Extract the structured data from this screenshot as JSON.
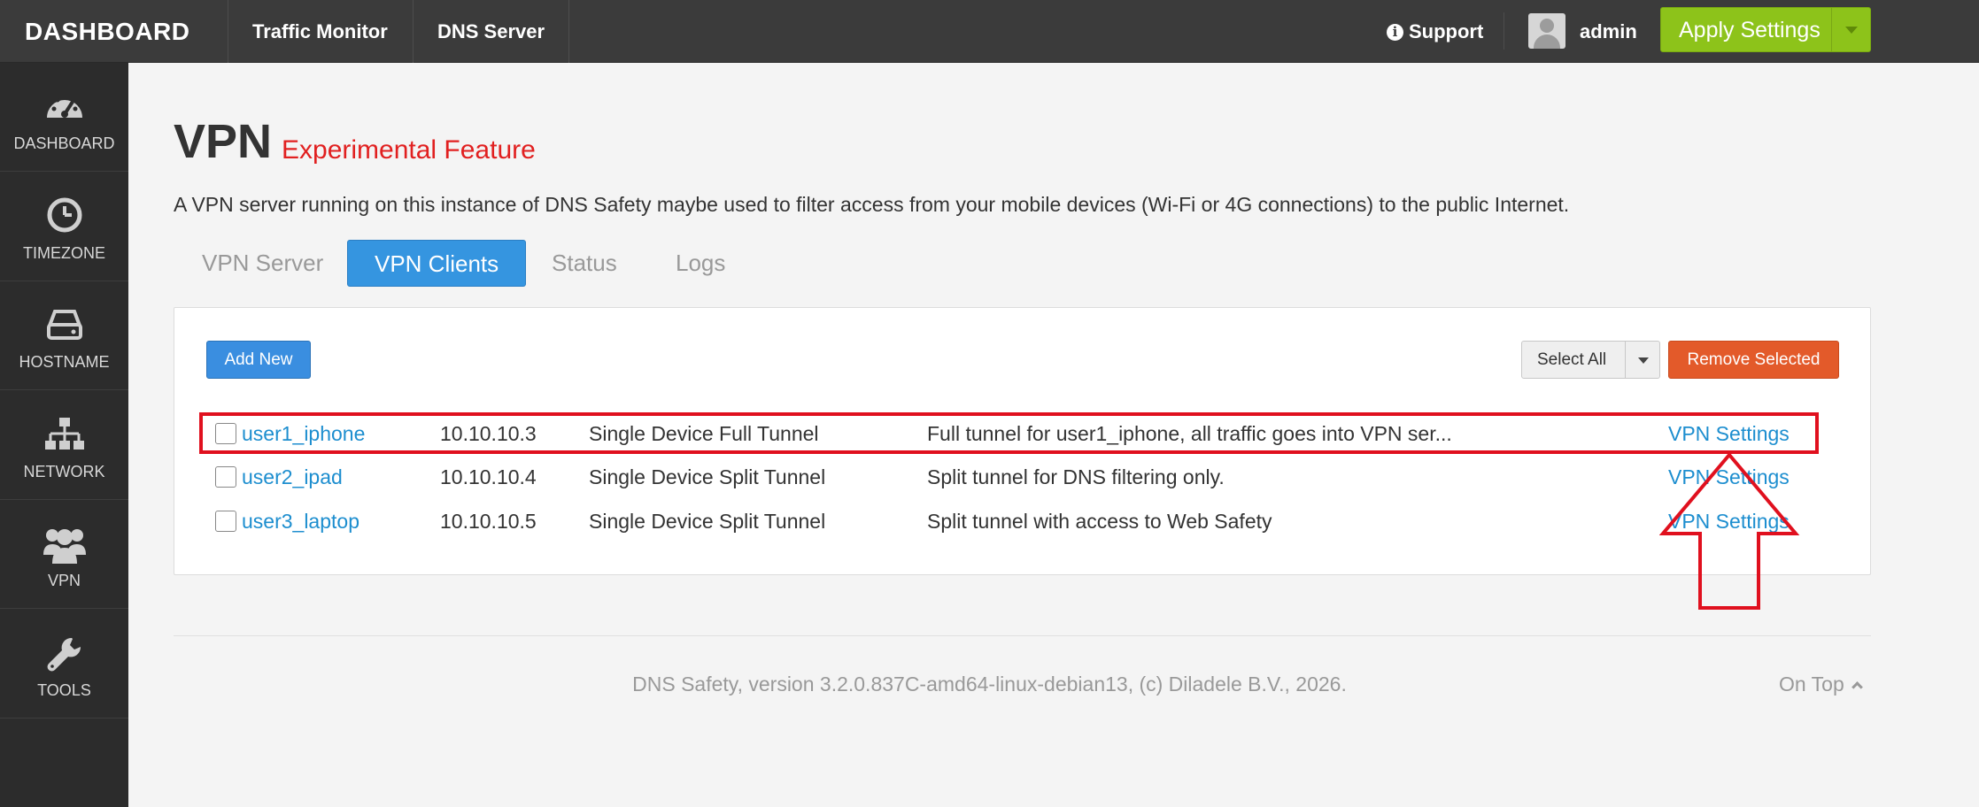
{
  "topbar": {
    "brand": "DASHBOARD",
    "nav": [
      "Traffic Monitor",
      "DNS Server"
    ],
    "support": "Support",
    "user": "admin",
    "apply": "Apply Settings"
  },
  "sidebar": {
    "items": [
      {
        "label": "DASHBOARD",
        "icon": "gauge-icon"
      },
      {
        "label": "TIMEZONE",
        "icon": "clock-icon"
      },
      {
        "label": "HOSTNAME",
        "icon": "server-drive-icon"
      },
      {
        "label": "NETWORK",
        "icon": "network-sitemap-icon"
      },
      {
        "label": "VPN",
        "icon": "users-icon"
      },
      {
        "label": "TOOLS",
        "icon": "wrench-icon"
      }
    ]
  },
  "page": {
    "title": "VPN",
    "badge": "Experimental Feature",
    "description": "A VPN server running on this instance of DNS Safety maybe used to filter access from your mobile devices (Wi-Fi or 4G connections) to the public Internet.",
    "tabs": [
      "VPN Server",
      "VPN Clients",
      "Status",
      "Logs"
    ],
    "active_tab": "VPN Clients"
  },
  "toolbar": {
    "add_new": "Add New",
    "select_all": "Select All",
    "remove_selected": "Remove Selected"
  },
  "clients": [
    {
      "name": "user1_iphone",
      "ip": "10.10.10.3",
      "type": "Single Device Full Tunnel",
      "description": "Full tunnel for user1_iphone, all traffic goes into VPN ser...",
      "action": "VPN Settings"
    },
    {
      "name": "user2_ipad",
      "ip": "10.10.10.4",
      "type": "Single Device Split Tunnel",
      "description": "Split tunnel for DNS filtering only.",
      "action": "VPN Settings"
    },
    {
      "name": "user3_laptop",
      "ip": "10.10.10.5",
      "type": "Single Device Split Tunnel",
      "description": "Split tunnel with access to Web Safety",
      "action": "VPN Settings"
    }
  ],
  "footer": {
    "version": "DNS Safety, version 3.2.0.837C-amd64-linux-debian13, (c) Diladele B.V., 2026.",
    "on_top": "On Top"
  },
  "colors": {
    "accent": "#3595e0",
    "apply": "#8dc31a",
    "danger": "#e35a2a",
    "highlight": "#e0101e",
    "link": "#1d8ecf"
  }
}
